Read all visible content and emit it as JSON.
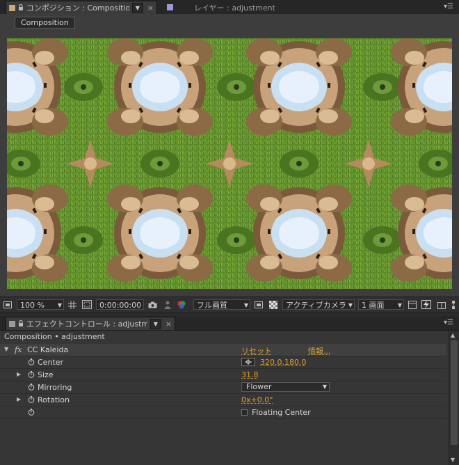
{
  "comp_panel": {
    "tabs": [
      {
        "label": "コンポジション : Composition"
      },
      {
        "label": "レイヤー : adjustment"
      }
    ],
    "breadcrumb_button": "Composition",
    "colors": {
      "swatch_comp": "#c8a878",
      "swatch_layer": "#9a9ad4"
    }
  },
  "viewer_toolbar": {
    "zoom": "100 %",
    "timecode": "0:00:00:00",
    "resolution": "フル画質",
    "camera": "アクティブカメラ",
    "views": "1 画面"
  },
  "effect_panel": {
    "tab_label": "エフェクトコントロール : adjustment",
    "breadcrumb": "Composition • adjustment",
    "effect": {
      "fx_symbol": "fx",
      "name": "CC Kaleida",
      "reset": "リセット",
      "about": "情報..."
    },
    "properties": [
      {
        "name": "Center",
        "value": "320.0,180.0"
      },
      {
        "name": "Size",
        "value": "31.8"
      },
      {
        "name": "Mirroring",
        "value": "Flower"
      },
      {
        "name": "Rotation",
        "value": "0x+0.0°"
      },
      {
        "name": "",
        "value": "Floating Center"
      }
    ]
  }
}
